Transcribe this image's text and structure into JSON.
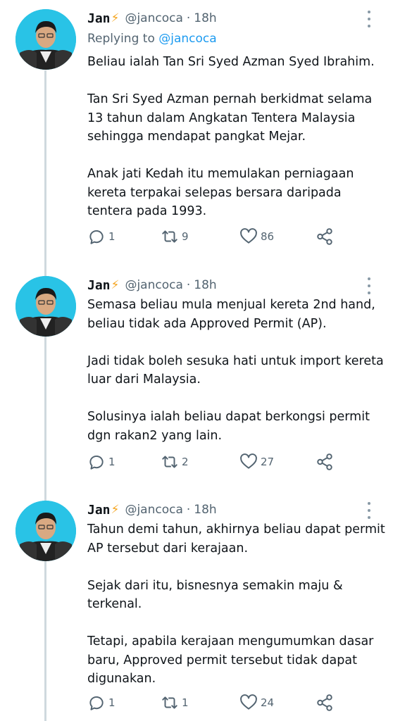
{
  "tweets": [
    {
      "name": "Jan",
      "name_emoji": "⚡",
      "handle": "@jancoca",
      "separator": "·",
      "time": "18h",
      "replying_prefix": "Replying to",
      "replying_handle": "@jancoca",
      "lines": [
        "Beliau ialah Tan Sri Syed Azman Syed Ibrahim.",
        "",
        "Tan Sri Syed Azman pernah berkidmat selama",
        "13 tahun dalam Angkatan Tentera Malaysia",
        "sehingga mendapat pangkat Mejar.",
        "",
        "Anak jati Kedah itu memulakan perniagaan",
        "kereta terpakai selepas bersara daripada",
        "tentera pada 1993."
      ],
      "replies": "1",
      "retweets": "9",
      "likes": "86"
    },
    {
      "name": "Jan",
      "name_emoji": "⚡",
      "handle": "@jancoca",
      "separator": "·",
      "time": "18h",
      "lines": [
        "Semasa beliau mula menjual kereta 2nd hand,",
        "beliau tidak ada Approved Permit (AP).",
        "",
        "Jadi tidak boleh sesuka hati untuk import kereta",
        "luar dari Malaysia.",
        "",
        "Solusinya ialah beliau dapat berkongsi permit",
        "dgn rakan2 yang lain."
      ],
      "replies": "1",
      "retweets": "2",
      "likes": "27"
    },
    {
      "name": "Jan",
      "name_emoji": "⚡",
      "handle": "@jancoca",
      "separator": "·",
      "time": "18h",
      "lines": [
        "Tahun demi tahun, akhirnya beliau dapat permit",
        "AP tersebut dari kerajaan.",
        "",
        "Sejak dari itu, bisnesnya semakin maju &",
        "terkenal.",
        "",
        "Tetapi, apabila kerajaan mengumumkan dasar",
        "baru, Approved permit tersebut tidak dapat",
        "digunakan."
      ],
      "replies": "1",
      "retweets": "1",
      "likes": "24"
    }
  ],
  "icons": {
    "reply": "reply-icon",
    "retweet": "retweet-icon",
    "like": "heart-icon",
    "share": "share-icon",
    "more": "more-icon"
  },
  "colors": {
    "link": "#1d9bf0",
    "secondary": "#536471",
    "avatar_bg": "#29c3e6",
    "bolt": "#f5a623"
  }
}
